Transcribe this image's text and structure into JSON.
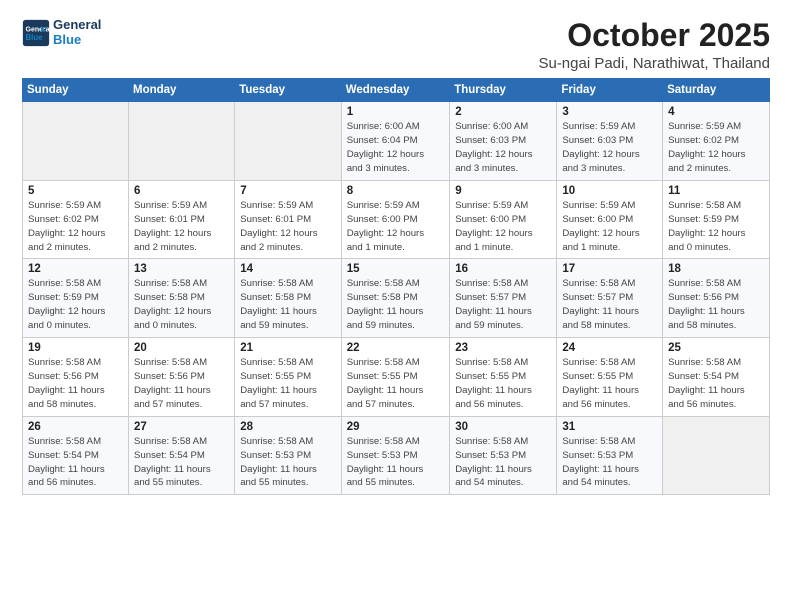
{
  "logo": {
    "line1": "General",
    "line2": "Blue"
  },
  "header": {
    "title": "October 2025",
    "subtitle": "Su-ngai Padi, Narathiwat, Thailand"
  },
  "weekdays": [
    "Sunday",
    "Monday",
    "Tuesday",
    "Wednesday",
    "Thursday",
    "Friday",
    "Saturday"
  ],
  "weeks": [
    [
      {
        "day": "",
        "info": ""
      },
      {
        "day": "",
        "info": ""
      },
      {
        "day": "",
        "info": ""
      },
      {
        "day": "1",
        "info": "Sunrise: 6:00 AM\nSunset: 6:04 PM\nDaylight: 12 hours\nand 3 minutes."
      },
      {
        "day": "2",
        "info": "Sunrise: 6:00 AM\nSunset: 6:03 PM\nDaylight: 12 hours\nand 3 minutes."
      },
      {
        "day": "3",
        "info": "Sunrise: 5:59 AM\nSunset: 6:03 PM\nDaylight: 12 hours\nand 3 minutes."
      },
      {
        "day": "4",
        "info": "Sunrise: 5:59 AM\nSunset: 6:02 PM\nDaylight: 12 hours\nand 2 minutes."
      }
    ],
    [
      {
        "day": "5",
        "info": "Sunrise: 5:59 AM\nSunset: 6:02 PM\nDaylight: 12 hours\nand 2 minutes."
      },
      {
        "day": "6",
        "info": "Sunrise: 5:59 AM\nSunset: 6:01 PM\nDaylight: 12 hours\nand 2 minutes."
      },
      {
        "day": "7",
        "info": "Sunrise: 5:59 AM\nSunset: 6:01 PM\nDaylight: 12 hours\nand 2 minutes."
      },
      {
        "day": "8",
        "info": "Sunrise: 5:59 AM\nSunset: 6:00 PM\nDaylight: 12 hours\nand 1 minute."
      },
      {
        "day": "9",
        "info": "Sunrise: 5:59 AM\nSunset: 6:00 PM\nDaylight: 12 hours\nand 1 minute."
      },
      {
        "day": "10",
        "info": "Sunrise: 5:59 AM\nSunset: 6:00 PM\nDaylight: 12 hours\nand 1 minute."
      },
      {
        "day": "11",
        "info": "Sunrise: 5:58 AM\nSunset: 5:59 PM\nDaylight: 12 hours\nand 0 minutes."
      }
    ],
    [
      {
        "day": "12",
        "info": "Sunrise: 5:58 AM\nSunset: 5:59 PM\nDaylight: 12 hours\nand 0 minutes."
      },
      {
        "day": "13",
        "info": "Sunrise: 5:58 AM\nSunset: 5:58 PM\nDaylight: 12 hours\nand 0 minutes."
      },
      {
        "day": "14",
        "info": "Sunrise: 5:58 AM\nSunset: 5:58 PM\nDaylight: 11 hours\nand 59 minutes."
      },
      {
        "day": "15",
        "info": "Sunrise: 5:58 AM\nSunset: 5:58 PM\nDaylight: 11 hours\nand 59 minutes."
      },
      {
        "day": "16",
        "info": "Sunrise: 5:58 AM\nSunset: 5:57 PM\nDaylight: 11 hours\nand 59 minutes."
      },
      {
        "day": "17",
        "info": "Sunrise: 5:58 AM\nSunset: 5:57 PM\nDaylight: 11 hours\nand 58 minutes."
      },
      {
        "day": "18",
        "info": "Sunrise: 5:58 AM\nSunset: 5:56 PM\nDaylight: 11 hours\nand 58 minutes."
      }
    ],
    [
      {
        "day": "19",
        "info": "Sunrise: 5:58 AM\nSunset: 5:56 PM\nDaylight: 11 hours\nand 58 minutes."
      },
      {
        "day": "20",
        "info": "Sunrise: 5:58 AM\nSunset: 5:56 PM\nDaylight: 11 hours\nand 57 minutes."
      },
      {
        "day": "21",
        "info": "Sunrise: 5:58 AM\nSunset: 5:55 PM\nDaylight: 11 hours\nand 57 minutes."
      },
      {
        "day": "22",
        "info": "Sunrise: 5:58 AM\nSunset: 5:55 PM\nDaylight: 11 hours\nand 57 minutes."
      },
      {
        "day": "23",
        "info": "Sunrise: 5:58 AM\nSunset: 5:55 PM\nDaylight: 11 hours\nand 56 minutes."
      },
      {
        "day": "24",
        "info": "Sunrise: 5:58 AM\nSunset: 5:55 PM\nDaylight: 11 hours\nand 56 minutes."
      },
      {
        "day": "25",
        "info": "Sunrise: 5:58 AM\nSunset: 5:54 PM\nDaylight: 11 hours\nand 56 minutes."
      }
    ],
    [
      {
        "day": "26",
        "info": "Sunrise: 5:58 AM\nSunset: 5:54 PM\nDaylight: 11 hours\nand 56 minutes."
      },
      {
        "day": "27",
        "info": "Sunrise: 5:58 AM\nSunset: 5:54 PM\nDaylight: 11 hours\nand 55 minutes."
      },
      {
        "day": "28",
        "info": "Sunrise: 5:58 AM\nSunset: 5:53 PM\nDaylight: 11 hours\nand 55 minutes."
      },
      {
        "day": "29",
        "info": "Sunrise: 5:58 AM\nSunset: 5:53 PM\nDaylight: 11 hours\nand 55 minutes."
      },
      {
        "day": "30",
        "info": "Sunrise: 5:58 AM\nSunset: 5:53 PM\nDaylight: 11 hours\nand 54 minutes."
      },
      {
        "day": "31",
        "info": "Sunrise: 5:58 AM\nSunset: 5:53 PM\nDaylight: 11 hours\nand 54 minutes."
      },
      {
        "day": "",
        "info": ""
      }
    ]
  ]
}
